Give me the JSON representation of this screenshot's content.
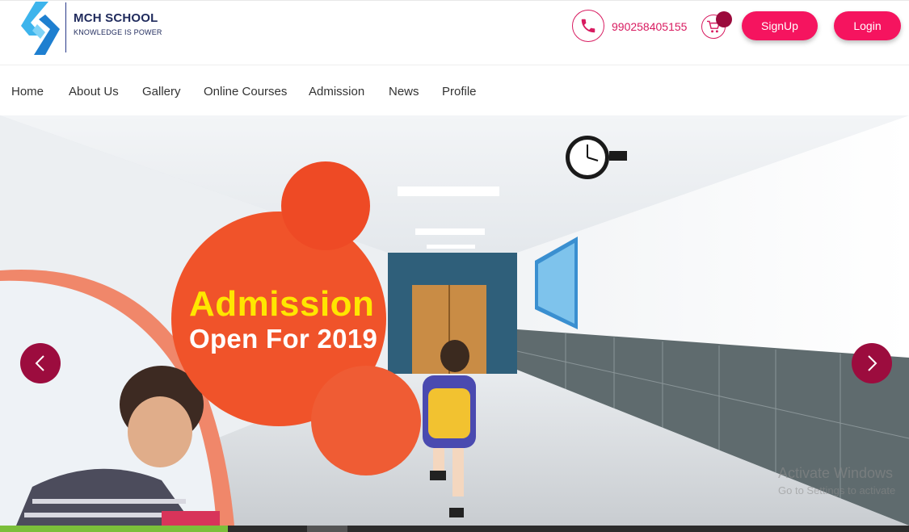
{
  "brand": {
    "name": "MCH SCHOOL",
    "tagline": "KNOWLEDGE IS POWER"
  },
  "header": {
    "phone": "990258405155",
    "signup_label": "SignUp",
    "login_label": "Login",
    "icons": {
      "phone": "phone-icon",
      "cart": "cart-icon"
    }
  },
  "nav": {
    "items": [
      {
        "label": "Home"
      },
      {
        "label": "About Us"
      },
      {
        "label": "Gallery"
      },
      {
        "label": "Online Courses"
      },
      {
        "label": "Admission"
      },
      {
        "label": "News"
      },
      {
        "label": "Profile"
      }
    ]
  },
  "hero": {
    "headline_line1": "Admission",
    "headline_line2": "Open For 2019",
    "prev_icon": "chevron-left-icon",
    "next_icon": "chevron-right-icon"
  },
  "watermark": {
    "line1": "Activate Windows",
    "line2": "Go to Settings to activate"
  },
  "colors": {
    "accent": "#f5145f",
    "brand_dark": "#1f2a5c",
    "arrow_bg": "#9c0c3e",
    "headline_yellow": "#ffe600",
    "bubble_orange": "#f0532a"
  }
}
